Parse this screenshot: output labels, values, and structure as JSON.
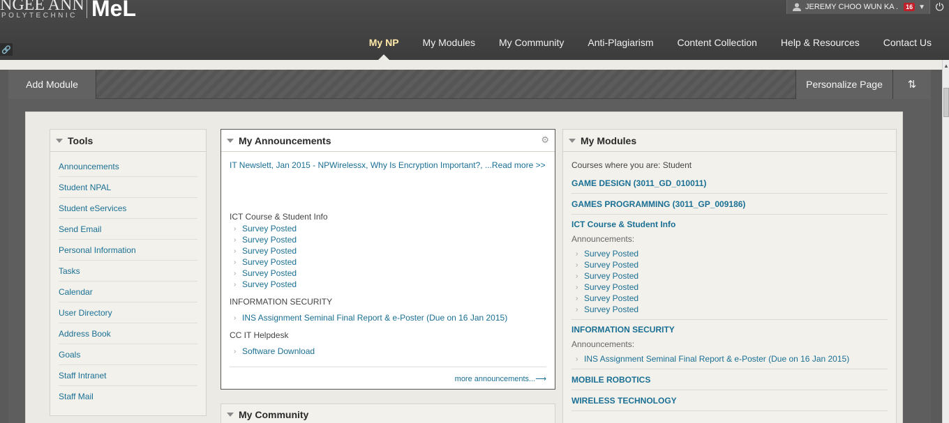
{
  "brand": {
    "school_name": "NGEE ANN",
    "school_sub": "POLYTECHNIC",
    "app_name": "MeL"
  },
  "user": {
    "name": "JEREMY CHOO WUN KA .",
    "notification_count": "16"
  },
  "nav": {
    "items": [
      {
        "label": "My NP",
        "active": true
      },
      {
        "label": "My Modules"
      },
      {
        "label": "My Community"
      },
      {
        "label": "Anti-Plagiarism"
      },
      {
        "label": "Content Collection"
      },
      {
        "label": "Help & Resources"
      },
      {
        "label": "Contact Us"
      }
    ]
  },
  "toolbar": {
    "add_module": "Add Module",
    "personalize": "Personalize Page"
  },
  "tools": {
    "title": "Tools",
    "items": [
      "Announcements",
      "Student NPAL",
      "Student eServices",
      "Send Email",
      "Personal Information",
      "Tasks",
      "Calendar",
      "User Directory",
      "Address Book",
      "Goals",
      "Staff Intranet",
      "Staff Mail"
    ]
  },
  "announcements": {
    "title": "My Announcements",
    "newsletter": "IT Newslett, Jan 2015 - NPWirelessx, Why Is Encryption Important?, ...Read more >>",
    "groups": [
      {
        "heading": "ICT Course & Student Info",
        "items": [
          "Survey Posted",
          "Survey Posted",
          "Survey Posted",
          "Survey Posted",
          "Survey Posted",
          "Survey Posted"
        ]
      },
      {
        "heading": "INFORMATION SECURITY",
        "items": [
          "INS Assignment Seminal Final Report & e-Poster (Due on 16 Jan 2015)"
        ]
      },
      {
        "heading": "CC IT Helpdesk",
        "items": [
          "Software Download"
        ]
      }
    ],
    "more": "more announcements...⟶"
  },
  "community": {
    "title": "My Community"
  },
  "my_modules": {
    "title": "My Modules",
    "subtitle": "Courses where you are: Student",
    "courses": [
      {
        "name": "GAME DESIGN (3011_GD_010011)"
      },
      {
        "name": "GAMES PROGRAMMING (3011_GP_009186)"
      },
      {
        "name": "ICT Course & Student Info",
        "announcements_label": "Announcements:",
        "items": [
          "Survey Posted",
          "Survey Posted",
          "Survey Posted",
          "Survey Posted",
          "Survey Posted",
          "Survey Posted"
        ]
      },
      {
        "name": "INFORMATION SECURITY",
        "announcements_label": "Announcements:",
        "items": [
          "INS Assignment Seminal Final Report & e-Poster (Due on 16 Jan 2015)"
        ]
      },
      {
        "name": "MOBILE ROBOTICS"
      },
      {
        "name": "WIRELESS TECHNOLOGY"
      }
    ]
  }
}
